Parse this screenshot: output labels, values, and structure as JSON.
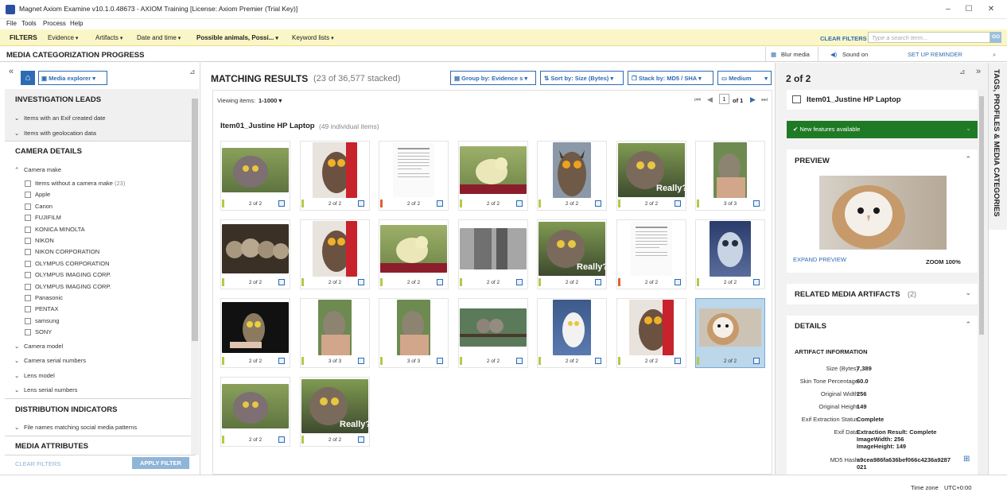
{
  "window": {
    "title": "Magnet Axiom Examine v10.1.0.48673 - AXIOM Training    [License: Axiom Premier (Trial Key)]",
    "controls": [
      "–",
      "☐",
      "✕"
    ]
  },
  "menu": [
    "File",
    "Tools",
    "Process",
    "Help"
  ],
  "filters": {
    "label": "FILTERS",
    "items": [
      "Evidence",
      "Artifacts",
      "Date and time",
      "Possible animals, Possi...",
      "Keyword lists"
    ],
    "clear": "CLEAR FILTERS",
    "search_placeholder": "Type a search term...",
    "go": "GO"
  },
  "progress_bar": {
    "title": "MEDIA CATEGORIZATION PROGRESS",
    "blur": "Blur media",
    "sound": "Sound on",
    "reminder": "SET UP REMINDER"
  },
  "left": {
    "explorer": "Media explorer",
    "sections": {
      "leads": "INVESTIGATION LEADS",
      "camera": "CAMERA DETAILS",
      "distribution": "DISTRIBUTION INDICATORS",
      "media": "MEDIA ATTRIBUTES"
    },
    "leads": [
      "Items with an Exif created date",
      "Items with geolocation data"
    ],
    "camera_make": "Camera make",
    "makes": [
      {
        "label": "Items without a camera make",
        "count": "(23)"
      },
      {
        "label": "Apple"
      },
      {
        "label": "Canon"
      },
      {
        "label": "FUJIFILM"
      },
      {
        "label": "KONICA MINOLTA"
      },
      {
        "label": "NIKON"
      },
      {
        "label": "NIKON CORPORATION"
      },
      {
        "label": "OLYMPUS CORPORATION"
      },
      {
        "label": "OLYMPUS IMAGING CORP."
      },
      {
        "label": "OLYMPUS IMAGING CORP."
      },
      {
        "label": "Panasonic"
      },
      {
        "label": "PENTAX"
      },
      {
        "label": "samsung"
      },
      {
        "label": "SONY"
      }
    ],
    "camera_sub": [
      "Camera model",
      "Camera serial numbers",
      "Lens model",
      "Lens serial numbers"
    ],
    "distribution": [
      "File names matching social media patterns"
    ],
    "clear": "CLEAR FILTERS",
    "apply": "APPLY FILTER"
  },
  "main": {
    "title": "MATCHING RESULTS",
    "count": "(23 of 36,577 stacked)",
    "group": "Group by: Evidence s",
    "sort": "Sort by: Size (Bytes)",
    "stack": "Stack by: MD5 / SHA",
    "size": "Medium",
    "viewing_label": "Viewing items:",
    "viewing_range": "1-1000",
    "page": "1",
    "of": "of 1",
    "group_title": "Item01_Justine HP Laptop",
    "group_count": "(49 individual items)",
    "thumbs": [
      {
        "label": "2 of 2",
        "tag": "green",
        "art": "owl-gray"
      },
      {
        "label": "2 of 2",
        "tag": "green",
        "art": "owl-red"
      },
      {
        "label": "2 of 2",
        "tag": "red",
        "art": "doc"
      },
      {
        "label": "2 of 2",
        "tag": "green",
        "art": "duck"
      },
      {
        "label": "2 of 2",
        "tag": "green",
        "art": "owl-horned"
      },
      {
        "label": "2 of 2",
        "tag": "green",
        "art": "owl-really"
      },
      {
        "label": "3 of 3",
        "tag": "green",
        "art": "hand-owl"
      },
      {
        "label": "2 of 2",
        "tag": "green",
        "art": "owlets"
      },
      {
        "label": "2 of 2",
        "tag": "green",
        "art": "owl-red"
      },
      {
        "label": "2 of 2",
        "tag": "green",
        "art": "duck"
      },
      {
        "label": "2 of 2",
        "tag": "green",
        "art": "tree"
      },
      {
        "label": "2 of 2",
        "tag": "green",
        "art": "owl-really"
      },
      {
        "label": "2 of 2",
        "tag": "red",
        "art": "doc"
      },
      {
        "label": "2 of 2",
        "tag": "green",
        "art": "owl-blue"
      },
      {
        "label": "2 of 2",
        "tag": "green",
        "art": "owl-dark"
      },
      {
        "label": "3 of 3",
        "tag": "green",
        "art": "hand-owl"
      },
      {
        "label": "3 of 3",
        "tag": "green",
        "art": "hand-owl"
      },
      {
        "label": "2 of 2",
        "tag": "green",
        "art": "owls-branch"
      },
      {
        "label": "2 of 2",
        "tag": "green",
        "art": "owl-snowy"
      },
      {
        "label": "2 of 2",
        "tag": "green",
        "art": "owl-red"
      },
      {
        "label": "2 of 2",
        "tag": "green",
        "art": "barn-owl",
        "selected": true
      },
      {
        "label": "2 of 2",
        "tag": "green",
        "art": "owl-gray"
      },
      {
        "label": "2 of 2",
        "tag": "green",
        "art": "owl-really"
      }
    ]
  },
  "right": {
    "counter": "2 of 2",
    "item_title": "Item01_Justine HP Laptop",
    "new_features": "New features available",
    "preview": "PREVIEW",
    "expand": "EXPAND PREVIEW",
    "zoom": "ZOOM 100%",
    "related": "RELATED MEDIA ARTIFACTS",
    "related_count": "(2)",
    "details": "DETAILS",
    "artifact_info": "ARTIFACT INFORMATION",
    "fields": [
      {
        "k": "Size (Bytes)",
        "v": "7,389"
      },
      {
        "k": "Skin Tone Percentage",
        "v": "60.0"
      },
      {
        "k": "Original Width",
        "v": "256"
      },
      {
        "k": "Original Height",
        "v": "149"
      },
      {
        "k": "Exif Extraction Status",
        "v": "Complete"
      }
    ],
    "exif_label": "Exif Data",
    "exif_lines": [
      "Extraction Result: Complete",
      "ImageWidth: 256",
      "ImageHeight: 149"
    ],
    "md5_label": "MD5 Hash",
    "md5_lines": [
      "a9cea986fa636bef066c4236a9287",
      "021"
    ]
  },
  "vertical_tab": "TAGS, PROFILES & MEDIA CATEGORIES",
  "status": {
    "tz_label": "Time zone",
    "tz_value": "UTC+0:00"
  }
}
